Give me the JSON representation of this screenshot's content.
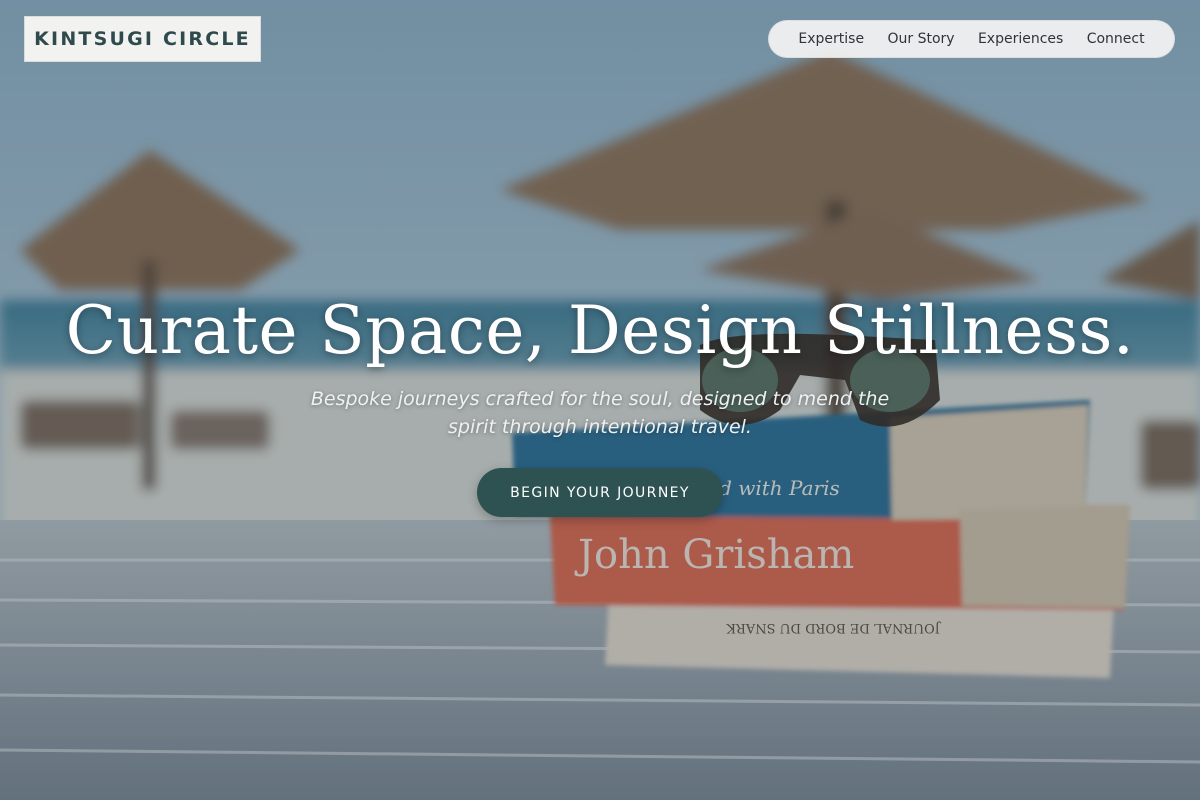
{
  "brand": {
    "name": "KINTSUGI CIRCLE"
  },
  "nav": {
    "items": [
      {
        "label": "Expertise"
      },
      {
        "label": "Our Story"
      },
      {
        "label": "Experiences"
      },
      {
        "label": "Connect"
      }
    ]
  },
  "hero": {
    "headline": "Curate Space, Design Stillness.",
    "subheadline": "Bespoke journeys crafted for the soul, designed to mend the spirit through intentional travel.",
    "cta_label": "BEGIN YOUR JOURNEY"
  },
  "background": {
    "book_titles": [
      "John Grisham",
      "...d with Paris",
      "JOURNAL DE BORD DU SNARK"
    ]
  },
  "colors": {
    "brand_text": "#2e4a4c",
    "cta_background": "#2e5152",
    "nav_background": "#f4f4f4"
  }
}
